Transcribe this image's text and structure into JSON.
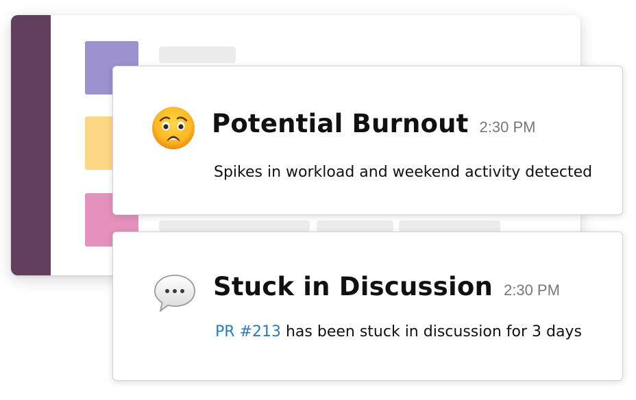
{
  "colors": {
    "sidebar": "#613f5d",
    "avatar_purple": "#9d91cf",
    "avatar_yellow": "#fdd785",
    "avatar_pink": "#e591bd",
    "link": "#2b7bb9",
    "timestamp": "#777777"
  },
  "notifications": [
    {
      "icon": "anguished-face-emoji-icon",
      "title": "Potential Burnout",
      "time": "2:30 PM",
      "message": "Spikes in workload and weekend activity detected"
    },
    {
      "icon": "speech-balloon-emoji-icon",
      "title": "Stuck in Discussion",
      "time": "2:30 PM",
      "link_text": "PR #213",
      "message": " has been stuck in discussion for 3 days"
    }
  ]
}
